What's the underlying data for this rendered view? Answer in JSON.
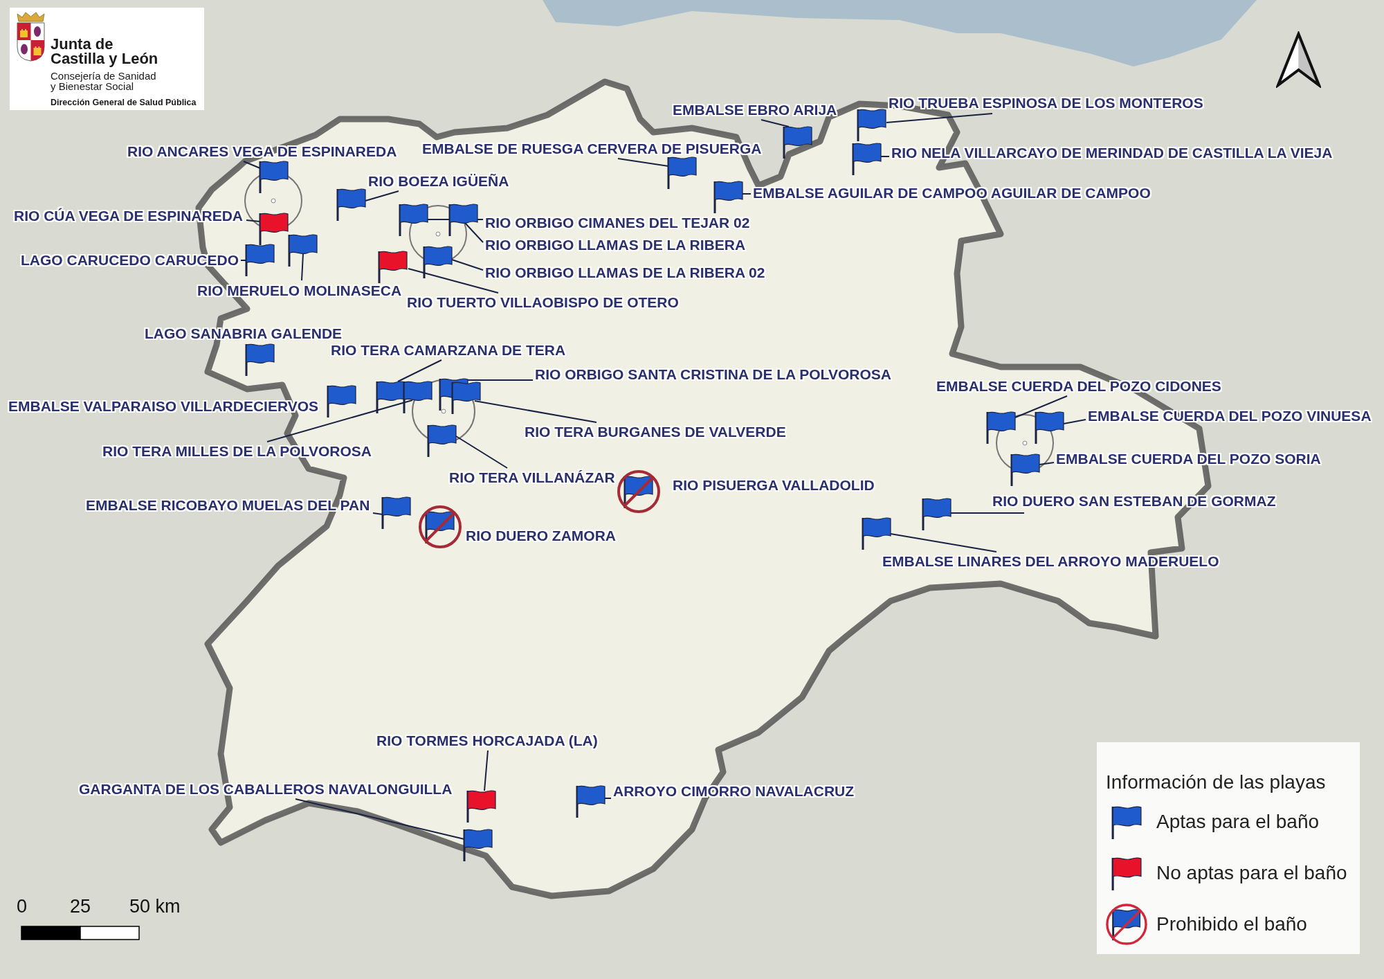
{
  "logo": {
    "title_lines": [
      "Junta de",
      "Castilla y León"
    ],
    "subtitle_lines": [
      "Consejería de Sanidad",
      "y Bienestar Social"
    ],
    "department": "Dirección General de Salud Pública"
  },
  "beaches": [
    {
      "name": "EMBALSE EBRO ARIJA",
      "kind": "apta"
    },
    {
      "name": "RIO TRUEBA ESPINOSA DE LOS MONTEROS",
      "kind": "apta"
    },
    {
      "name": "RIO ANCARES VEGA DE ESPINAREDA",
      "kind": "apta"
    },
    {
      "name": "EMBALSE DE RUESGA CERVERA DE PISUERGA",
      "kind": "apta"
    },
    {
      "name": "RIO NELA VILLARCAYO DE MERINDAD DE CASTILLA LA VIEJA",
      "kind": "apta"
    },
    {
      "name": "RIO BOEZA IGÜEÑA",
      "kind": "apta"
    },
    {
      "name": "EMBALSE AGUILAR DE CAMPOO AGUILAR DE CAMPOO",
      "kind": "apta"
    },
    {
      "name": "RIO CÚA VEGA DE ESPINAREDA",
      "kind": "no_apta"
    },
    {
      "name": "RIO ORBIGO CIMANES DEL TEJAR 02",
      "kind": "apta"
    },
    {
      "name": "RIO ORBIGO LLAMAS DE LA RIBERA",
      "kind": "apta"
    },
    {
      "name": "LAGO CARUCEDO CARUCEDO",
      "kind": "apta"
    },
    {
      "name": "RIO ORBIGO LLAMAS DE LA RIBERA 02",
      "kind": "apta"
    },
    {
      "name": "RIO MERUELO MOLINASECA",
      "kind": "apta"
    },
    {
      "name": "RIO TUERTO VILLAOBISPO DE OTERO",
      "kind": "no_apta"
    },
    {
      "name": "LAGO SANABRIA GALENDE",
      "kind": "apta"
    },
    {
      "name": "RIO TERA CAMARZANA DE TERA",
      "kind": "apta"
    },
    {
      "name": "RIO ORBIGO SANTA CRISTINA DE LA POLVOROSA",
      "kind": "apta"
    },
    {
      "name": "EMBALSE CUERDA DEL POZO CIDONES",
      "kind": "apta"
    },
    {
      "name": "EMBALSE VALPARAISO VILLARDECIERVOS",
      "kind": "apta"
    },
    {
      "name": "EMBALSE CUERDA DEL POZO VINUESA",
      "kind": "apta"
    },
    {
      "name": "RIO TERA BURGANES DE VALVERDE",
      "kind": "apta"
    },
    {
      "name": "RIO TERA MILLES DE LA POLVOROSA",
      "kind": "apta"
    },
    {
      "name": "EMBALSE CUERDA DEL POZO SORIA",
      "kind": "apta"
    },
    {
      "name": "RIO TERA VILLANÁZAR",
      "kind": "apta"
    },
    {
      "name": "RIO PISUERGA VALLADOLID",
      "kind": "prohibida"
    },
    {
      "name": "EMBALSE RICOBAYO MUELAS DEL PAN",
      "kind": "apta"
    },
    {
      "name": "RIO DUERO SAN ESTEBAN DE GORMAZ",
      "kind": "apta"
    },
    {
      "name": "RIO DUERO ZAMORA",
      "kind": "prohibida"
    },
    {
      "name": "EMBALSE LINARES DEL ARROYO MADERUELO",
      "kind": "apta"
    },
    {
      "name": "RIO TORMES HORCAJADA (LA)",
      "kind": "no_apta"
    },
    {
      "name": "GARGANTA DE LOS CABALLEROS NAVALONGUILLA",
      "kind": "apta"
    },
    {
      "name": "ARROYO CIMORRO NAVALACRUZ",
      "kind": "apta"
    }
  ],
  "legend": {
    "title": "Información de las playas",
    "items": [
      {
        "kind": "apta",
        "label": "Aptas para el baño"
      },
      {
        "kind": "no_apta",
        "label": "No aptas para el baño"
      },
      {
        "kind": "prohibida",
        "label": "Prohibido el baño"
      }
    ]
  },
  "scale_bar": {
    "labels": [
      "0",
      "25",
      "50 km"
    ]
  }
}
